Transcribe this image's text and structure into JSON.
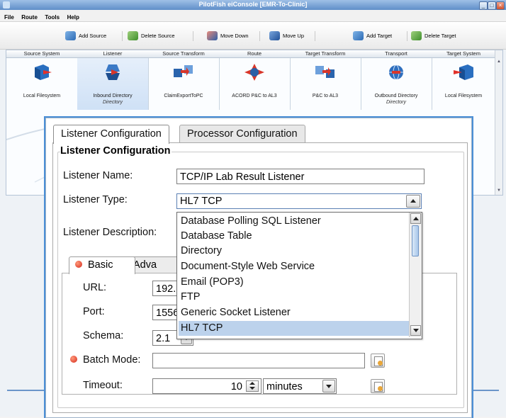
{
  "window": {
    "title": "PilotFish eiConsole [EMR-To-Clinic]"
  },
  "menu": [
    "File",
    "Route",
    "Tools",
    "Help"
  ],
  "toolbar": {
    "add_source": "Add Source",
    "delete_source": "Delete Source",
    "move_down": "Move Down",
    "move_up": "Move Up",
    "add_target": "Add Target",
    "delete_target": "Delete Target"
  },
  "flow": {
    "columns": [
      {
        "header": "Source System",
        "label": "Local Filesystem",
        "sub": "",
        "icon": "cube-arrow-icon"
      },
      {
        "header": "Listener",
        "label": "Inbound Directory",
        "sub": "Directory",
        "icon": "listener-arrow-icon"
      },
      {
        "header": "Source Transform",
        "label": "ClaimExportToPC",
        "sub": "",
        "icon": "xml-transform-icon"
      },
      {
        "header": "Route",
        "label": "ACORD P&C to AL3",
        "sub": "",
        "icon": "xml-route-icon"
      },
      {
        "header": "Target Transform",
        "label": "P&C to AL3",
        "sub": "",
        "icon": "xml-transform-icon"
      },
      {
        "header": "Transport",
        "label": "Outbound Directory",
        "sub": "Directory",
        "icon": "globe-icon"
      },
      {
        "header": "Target System",
        "label": "Local Filesystem",
        "sub": "",
        "icon": "cube-arrow-icon"
      }
    ]
  },
  "dialog": {
    "tabs": [
      "Listener Configuration",
      "Processor Configuration"
    ],
    "group_title": "Listener Configuration",
    "listener_name_label": "Listener Name:",
    "listener_name_value": "TCP/IP Lab Result Listener",
    "listener_type_label": "Listener Type:",
    "listener_type_value": "HL7 TCP",
    "listener_description_label": "Listener Description:",
    "type_options": [
      "Database Polling SQL Listener",
      "Database Table",
      "Directory",
      "Document-Style Web Service",
      "Email (POP3)",
      "FTP",
      "Generic Socket Listener",
      "HL7 TCP"
    ],
    "selected_option": "HL7 TCP",
    "inner_tabs": [
      "Basic",
      "Adva"
    ],
    "url_label": "URL:",
    "url_value": "192.1",
    "port_label": "Port:",
    "port_value": "1556",
    "schema_label": "Schema:",
    "schema_value": "2.1",
    "batch_mode_label": "Batch Mode:",
    "batch_mode_value": "",
    "timeout_label": "Timeout:",
    "timeout_value": "10",
    "timeout_unit": "minutes"
  },
  "colors": {
    "accent": "#4b8fd6",
    "selection": "#bcd2ec",
    "required": "#d5281c"
  }
}
